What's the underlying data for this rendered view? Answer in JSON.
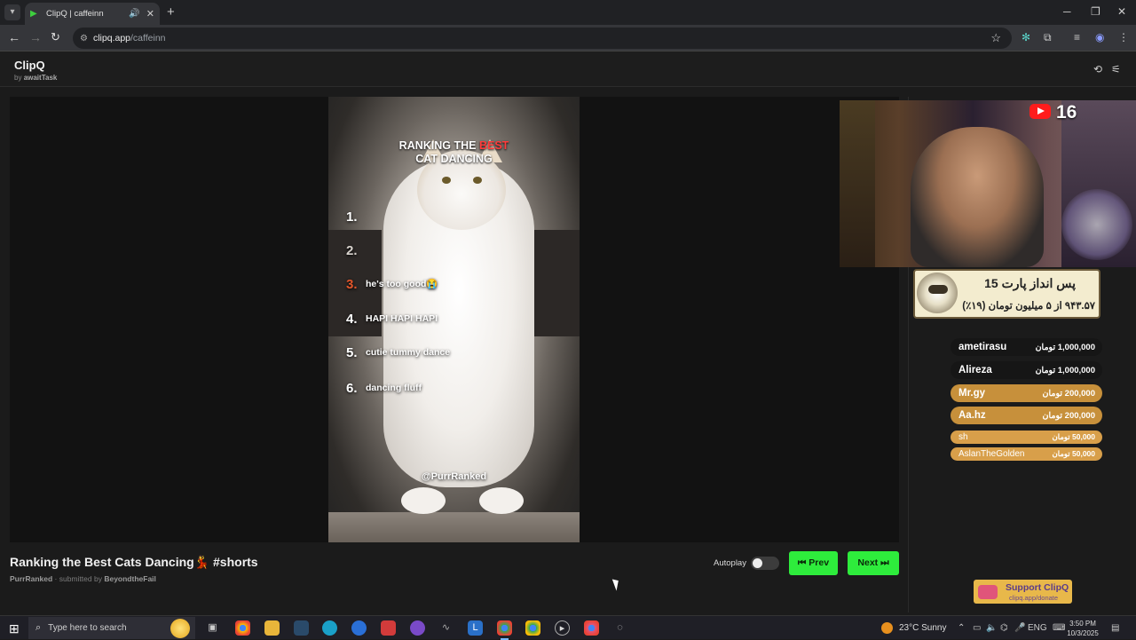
{
  "browser": {
    "tab_title": "ClipQ | caffeinn",
    "url_host": "clipq.app",
    "url_path": "/caffeinn"
  },
  "app": {
    "name": "ClipQ",
    "by_prefix": "by",
    "by_name": "awaitTask"
  },
  "video": {
    "overlay_title_1": "RANKING THE",
    "overlay_title_red": "BEST",
    "overlay_title_2": "CAT DANCING",
    "rankings": [
      {
        "num": "1.",
        "text": ""
      },
      {
        "num": "2.",
        "text": ""
      },
      {
        "num": "3.",
        "text": "he's too good😭"
      },
      {
        "num": "4.",
        "text": "HAPI HAPI HAPI"
      },
      {
        "num": "5.",
        "text": "cutie tummy dance"
      },
      {
        "num": "6.",
        "text": "dancing fluff"
      }
    ],
    "watermark": "@PurrRanked",
    "title": "Ranking the Best Cats Dancing💃 #shorts",
    "channel": "PurrRanked",
    "submitted_by_label": "submitted by",
    "submitted_by": "BeyondtheFail"
  },
  "controls": {
    "autoplay_label": "Autoplay",
    "autoplay_on": false,
    "prev_label": "⏮ Prev",
    "next_label": "Next ⏭"
  },
  "stream_overlay": {
    "youtube_count": "16",
    "goal_line1": "پس انداز پارت 15",
    "goal_line2": "۹۴۳.۵۷ از ۵ میلیون تومان (۱۹٪)",
    "donors": [
      {
        "name": "ametirasu",
        "amount": "1,000,000 تومان"
      },
      {
        "name": "Alireza",
        "amount": "1,000,000 تومان"
      },
      {
        "name": "Mr.gy",
        "amount": "200,000 تومان"
      },
      {
        "name": "Aa.hz",
        "amount": "200,000 تومان"
      },
      {
        "name": "sh",
        "amount": "50,000 تومان"
      },
      {
        "name": "AslanTheGolden",
        "amount": "50,000 تومان"
      }
    ]
  },
  "support": {
    "title": "Support ClipQ",
    "url": "clipq.app/donate"
  },
  "taskbar": {
    "search_placeholder": "Type here to search",
    "weather": "23°C  Sunny",
    "language": "ENG",
    "time": "3:50 PM",
    "date": "10/3/2025"
  }
}
